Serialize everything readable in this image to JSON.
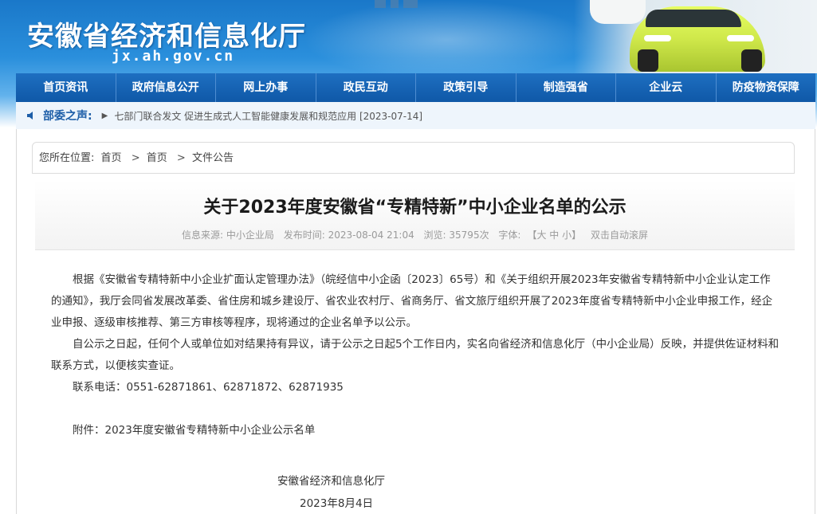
{
  "header": {
    "site_title": "安徽省经济和信息化厅",
    "site_url": "jx.ah.gov.cn"
  },
  "nav": {
    "items": [
      "首页资讯",
      "政府信息公开",
      "网上办事",
      "政民互动",
      "政策引导",
      "制造强省",
      "企业云",
      "防疫物资保障"
    ]
  },
  "notice": {
    "label": "部委之声:",
    "text": "七部门联合发文 促进生成式人工智能健康发展和规范应用 [2023-07-14]"
  },
  "breadcrumb": {
    "prefix": "您所在位置:",
    "items": [
      "首页",
      "首页",
      "文件公告"
    ],
    "separator": ">"
  },
  "article": {
    "title": "关于2023年度安徽省“专精特新”中小企业名单的公示",
    "source": "信息来源:  中小企业局",
    "published": "发布时间:  2023-08-04 21:04",
    "views": "浏览:  35795次",
    "font_label": "字体:",
    "font_sizes": "【大 中 小】",
    "autoscroll": "双击自动滚屏",
    "paragraphs": [
      "根据《安徽省专精特新中小企业扩面认定管理办法》（皖经信中小企函〔2023〕65号）和《关于组织开展2023年安徽省专精特新中小企业认定工作的通知》，我厅会同省发展改革委、省住房和城乡建设厅、省农业农村厅、省商务厅、省文旅厅组织开展了2023年度省专精特新中小企业申报工作，经企业申报、逐级审核推荐、第三方审核等程序，现将通过的企业名单予以公示。",
      "自公示之日起，任何个人或单位如对结果持有异议，请于公示之日起5个工作日内，实名向省经济和信息化厅（中小企业局）反映，并提供佐证材料和联系方式，以便核实查证。",
      "联系电话：0551-62871861、62871872、62871935"
    ],
    "attachment": "附件：2023年度安徽省专精特新中小企业公示名单",
    "signature": "安徽省经济和信息化厅",
    "date": "2023年8月4日"
  },
  "colors": {
    "nav_bg": "#1565b6",
    "notice_label": "#1d5ea8",
    "banner_top": "#1a78c9"
  }
}
